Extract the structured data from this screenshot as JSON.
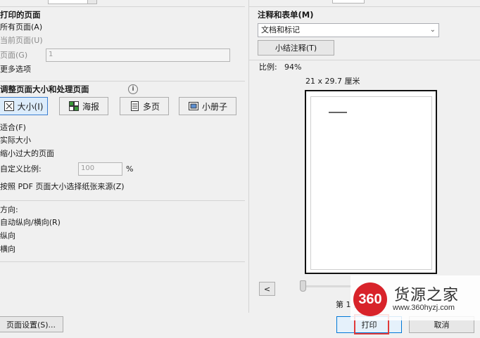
{
  "pages": {
    "title": "打印的页面",
    "all": "所有页面(A)",
    "current": "当前页面(U)",
    "range_label": "页面(G)",
    "range_value": "1",
    "more": "更多选项"
  },
  "sizing": {
    "title": "调整页面大小和处理页面",
    "info_icon": "info-icon",
    "modes": [
      {
        "label": "大小(I)",
        "icon": "size-icon"
      },
      {
        "label": "海报",
        "icon": "poster-icon"
      },
      {
        "label": "多页",
        "icon": "multipage-icon"
      },
      {
        "label": "小册子",
        "icon": "booklet-icon"
      }
    ],
    "fit": "适合(F)",
    "actual": "实际大小",
    "shrink": "缩小过大的页面",
    "custom_label": "自定义比例:",
    "custom_value": "100",
    "percent": "%",
    "paper_source": "按照 PDF 页面大小选择纸张来源(Z)"
  },
  "orientation": {
    "title": "方向:",
    "auto": "自动纵向/横向(R)",
    "portrait": "纵向",
    "landscape": "横向"
  },
  "page_setup_label": "页面设置(S)...",
  "comments": {
    "title": "注释和表单(M)",
    "selected": "文档和标记",
    "summarize_label": "小结注释(T)"
  },
  "preview": {
    "scale_label": "比例:",
    "scale_value": "94%",
    "paper_size": "21 x 29.7 厘米",
    "prev_label": "<",
    "page_indicator": "第 1 页"
  },
  "footer": {
    "print_label": "打印",
    "cancel_label": "取消"
  },
  "watermark": {
    "logo": "360",
    "name": "货源之家",
    "url": "www.360hyzj.com"
  },
  "colors": {
    "accent": "#3c7fd1",
    "watermark_red": "#d8232a"
  }
}
